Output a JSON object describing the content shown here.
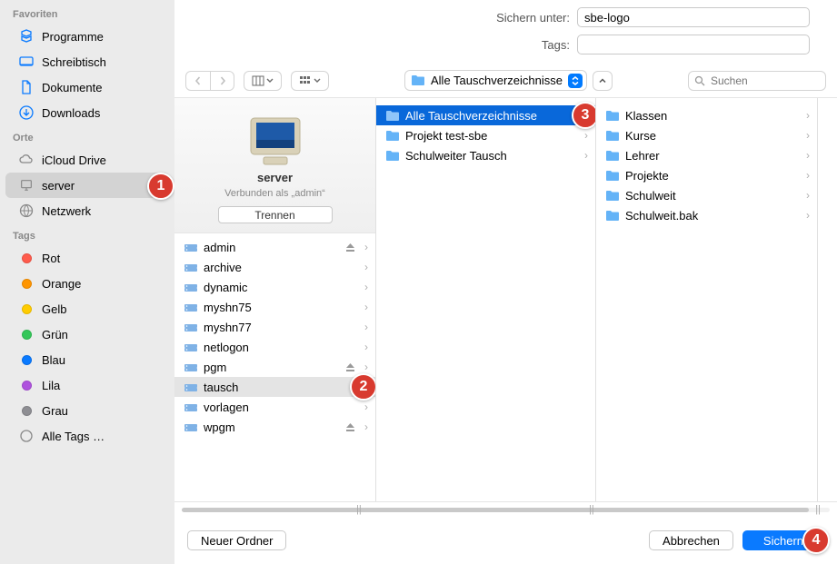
{
  "labels": {
    "save_as": "Sichern unter:",
    "tags": "Tags:",
    "save_as_value": "sbe-logo",
    "search_placeholder": "Suchen",
    "new_folder": "Neuer Ordner",
    "cancel": "Abbrechen",
    "save": "Sichern"
  },
  "location": {
    "label": "Alle Tauschverzeichnisse"
  },
  "sidebar": {
    "favorites": {
      "title": "Favoriten",
      "items": [
        {
          "label": "Programme"
        },
        {
          "label": "Schreibtisch"
        },
        {
          "label": "Dokumente"
        },
        {
          "label": "Downloads"
        }
      ]
    },
    "locations": {
      "title": "Orte",
      "items": [
        {
          "label": "iCloud Drive"
        },
        {
          "label": "server"
        },
        {
          "label": "Netzwerk"
        }
      ]
    },
    "tags": {
      "title": "Tags",
      "items": [
        {
          "label": "Rot",
          "color": "#ff5b4c"
        },
        {
          "label": "Orange",
          "color": "#ff9500"
        },
        {
          "label": "Gelb",
          "color": "#ffcc00"
        },
        {
          "label": "Grün",
          "color": "#34c759"
        },
        {
          "label": "Blau",
          "color": "#0a7aff"
        },
        {
          "label": "Lila",
          "color": "#af52de"
        },
        {
          "label": "Grau",
          "color": "#8e8e93"
        },
        {
          "label": "Alle Tags …"
        }
      ]
    }
  },
  "server_panel": {
    "name": "server",
    "connected_as": "Verbunden als „admin“",
    "disconnect": "Trennen",
    "shares": [
      {
        "label": "admin",
        "eject": true
      },
      {
        "label": "archive"
      },
      {
        "label": "dynamic"
      },
      {
        "label": "myshn75"
      },
      {
        "label": "myshn77"
      },
      {
        "label": "netlogon"
      },
      {
        "label": "pgm",
        "eject": true
      },
      {
        "label": "tausch",
        "selected": true
      },
      {
        "label": "vorlagen"
      },
      {
        "label": "wpgm",
        "eject": true
      }
    ]
  },
  "column1": {
    "items": [
      {
        "label": "Alle Tauschverzeichnisse",
        "selected": true
      },
      {
        "label": "Projekt test-sbe"
      },
      {
        "label": "Schulweiter Tausch"
      }
    ]
  },
  "column2": {
    "items": [
      {
        "label": "Klassen"
      },
      {
        "label": "Kurse"
      },
      {
        "label": "Lehrer"
      },
      {
        "label": "Projekte"
      },
      {
        "label": "Schulweit"
      },
      {
        "label": "Schulweit.bak"
      }
    ]
  },
  "annotations": {
    "a1": "1",
    "a2": "2",
    "a3": "3",
    "a4": "4"
  }
}
